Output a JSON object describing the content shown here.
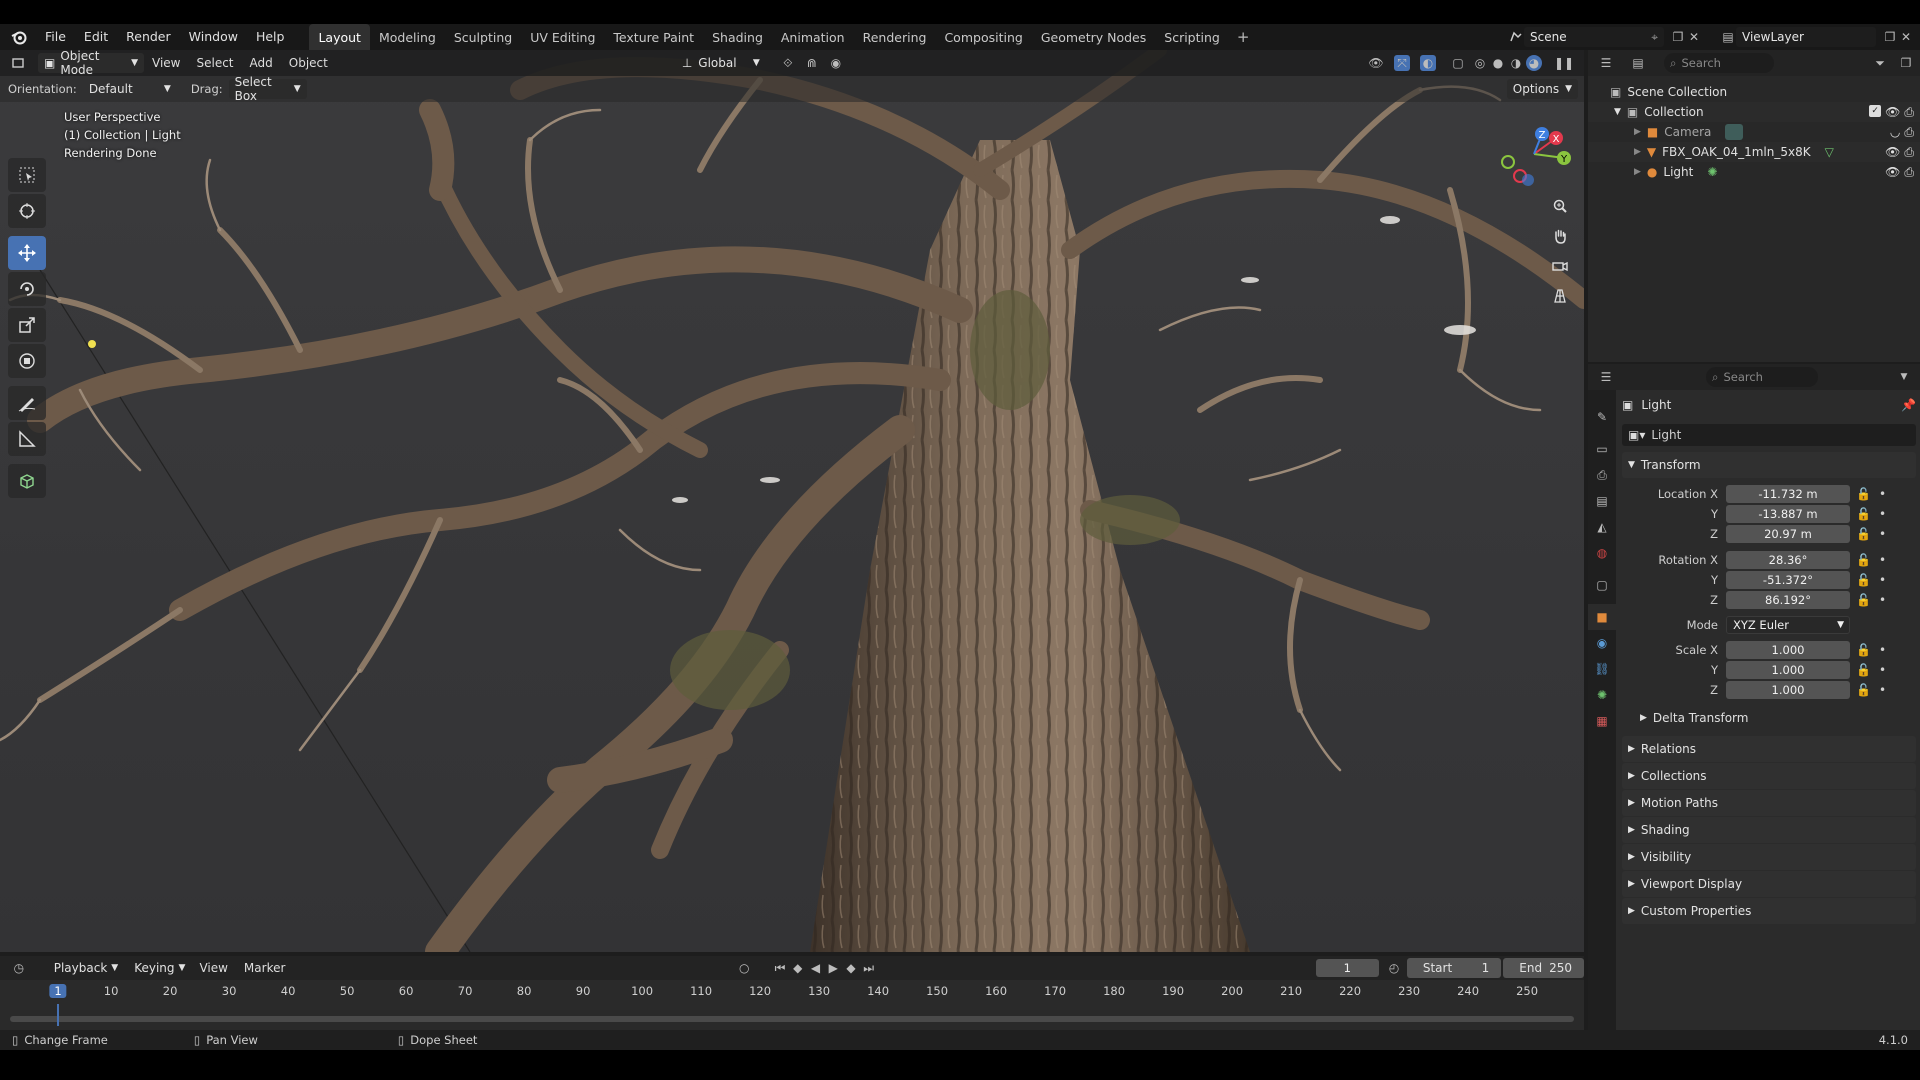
{
  "menubar": {
    "items": [
      "File",
      "Edit",
      "Render",
      "Window",
      "Help"
    ],
    "workspaces": [
      "Layout",
      "Modeling",
      "Sculpting",
      "UV Editing",
      "Texture Paint",
      "Shading",
      "Animation",
      "Rendering",
      "Compositing",
      "Geometry Nodes",
      "Scripting"
    ],
    "active_workspace": "Layout",
    "add_tab": "+",
    "scene": "Scene",
    "view_layer": "ViewLayer"
  },
  "viewport": {
    "mode": "Object Mode",
    "menus": [
      "View",
      "Select",
      "Add",
      "Object"
    ],
    "orientation_label": "Orientation:",
    "orientation_value": "Default",
    "drag_label": "Drag:",
    "drag_value": "Select Box",
    "transform_orientation": "Global",
    "options_label": "Options",
    "overlay_lines": [
      "User Perspective",
      "(1) Collection | Light",
      "Rendering Done"
    ],
    "gizmo_axes": [
      "X",
      "Y",
      "Z"
    ]
  },
  "outliner": {
    "search_placeholder": "Search",
    "root": "Scene Collection",
    "collection": "Collection",
    "items": [
      {
        "name": "Camera",
        "icon": "camera-icon"
      },
      {
        "name": "FBX_OAK_04_1mln_5x8K",
        "icon": "mesh-icon"
      },
      {
        "name": "Light",
        "icon": "light-icon"
      }
    ]
  },
  "properties": {
    "search_placeholder": "Search",
    "object_title": "Light",
    "object_name": "Light",
    "transform_label": "Transform",
    "location": {
      "label": "Location X",
      "x": "-11.732 m",
      "y": "-13.887 m",
      "z": "20.97 m"
    },
    "rotation": {
      "label": "Rotation X",
      "x": "28.36°",
      "y": "-51.372°",
      "z": "86.192°"
    },
    "mode_label": "Mode",
    "mode_value": "XYZ Euler",
    "scale": {
      "label": "Scale X",
      "x": "1.000",
      "y": "1.000",
      "z": "1.000"
    },
    "axis_y": "Y",
    "axis_z": "Z",
    "delta_transform": "Delta Transform",
    "panels": [
      "Relations",
      "Collections",
      "Motion Paths",
      "Shading",
      "Visibility",
      "Viewport Display",
      "Custom Properties"
    ]
  },
  "timeline": {
    "menus": [
      "Playback",
      "Keying",
      "View",
      "Marker"
    ],
    "current_frame": "1",
    "start_label": "Start",
    "start_value": "1",
    "end_label": "End",
    "end_value": "250",
    "ruler_ticks": [
      "1",
      "10",
      "20",
      "30",
      "40",
      "50",
      "60",
      "70",
      "80",
      "90",
      "100",
      "110",
      "120",
      "130",
      "140",
      "150",
      "160",
      "170",
      "180",
      "190",
      "200",
      "210",
      "220",
      "230",
      "240",
      "250"
    ]
  },
  "statusbar": {
    "items": [
      "Change Frame",
      "Pan View",
      "Dope Sheet"
    ],
    "version": "4.1.0"
  },
  "colors": {
    "accent": "#4772b3",
    "axis_x": "#e3394d",
    "axis_y": "#8bc53f",
    "axis_z": "#3f7fe0"
  }
}
